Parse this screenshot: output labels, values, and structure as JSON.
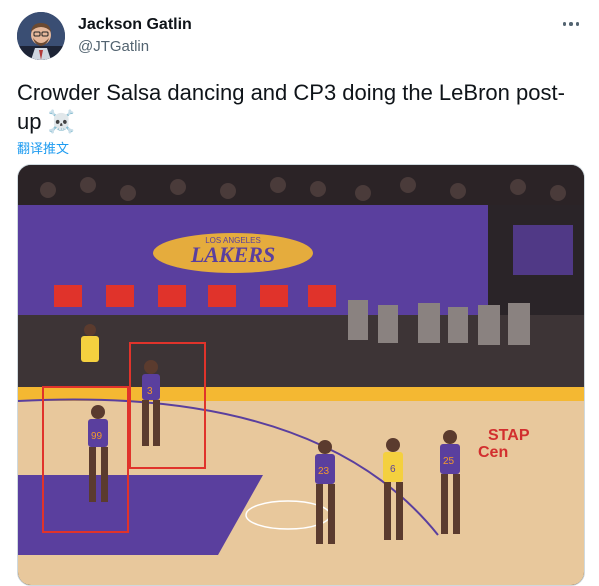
{
  "author": {
    "name": "Jackson Gatlin",
    "handle": "@JTGatlin"
  },
  "tweet": {
    "text": "Crowder Salsa dancing and CP3 doing the LeBron post-up",
    "emoji": "☠️",
    "translate_label": "翻译推文"
  },
  "media": {
    "banner_text": "LOS ANGELES",
    "logo_text": "LAKERS",
    "court_sign_line1": "STAP",
    "court_sign_line2": "Cen",
    "jersey_numbers": [
      "3",
      "99",
      "25",
      "23",
      "6",
      "25"
    ],
    "colors": {
      "purple": "#5a3f9e",
      "gold": "#f4b832",
      "highlight": "#e0332b"
    }
  },
  "icons": {
    "more": "more-dots-icon",
    "emoji": "skull-crossbones-icon"
  }
}
